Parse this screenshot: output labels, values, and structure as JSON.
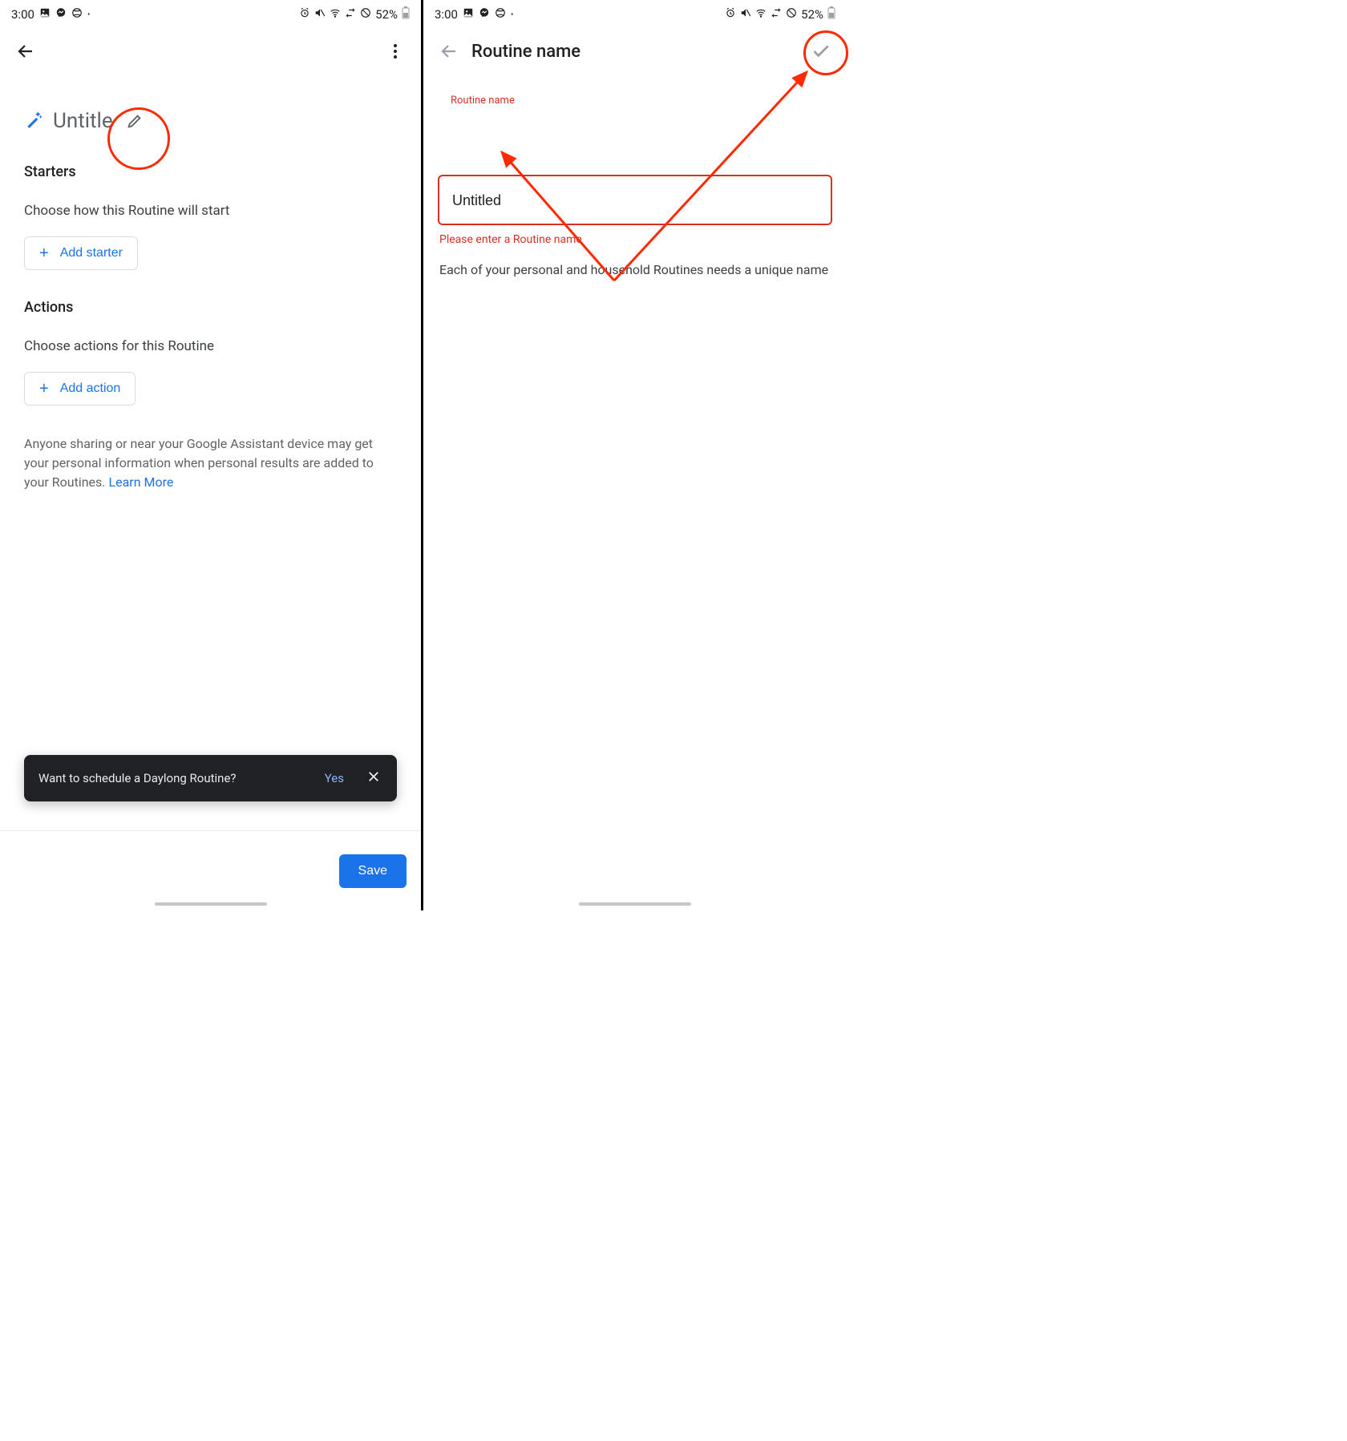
{
  "statusbar": {
    "time": "3:00",
    "battery": "52%"
  },
  "panel1": {
    "routine_title": "Untitle",
    "starters_heading": "Starters",
    "starters_desc": "Choose how this Routine will start",
    "add_starter_label": "Add starter",
    "actions_heading": "Actions",
    "actions_desc": "Choose actions for this Routine",
    "add_action_label": "Add action",
    "disclaimer_text": "Anyone sharing or near your Google Assistant device may get your personal information when personal results are added to your Routines. ",
    "learn_more_label": "Learn More",
    "snackbar_text": "Want to schedule a Daylong Routine?",
    "snackbar_yes": "Yes",
    "save_label": "Save"
  },
  "panel2": {
    "appbar_title": "Routine name",
    "floating_label": "Routine name",
    "input_value": "Untitled",
    "error_msg": "Please enter a Routine name",
    "helper_text": "Each of your personal and household Routines needs a unique name"
  }
}
